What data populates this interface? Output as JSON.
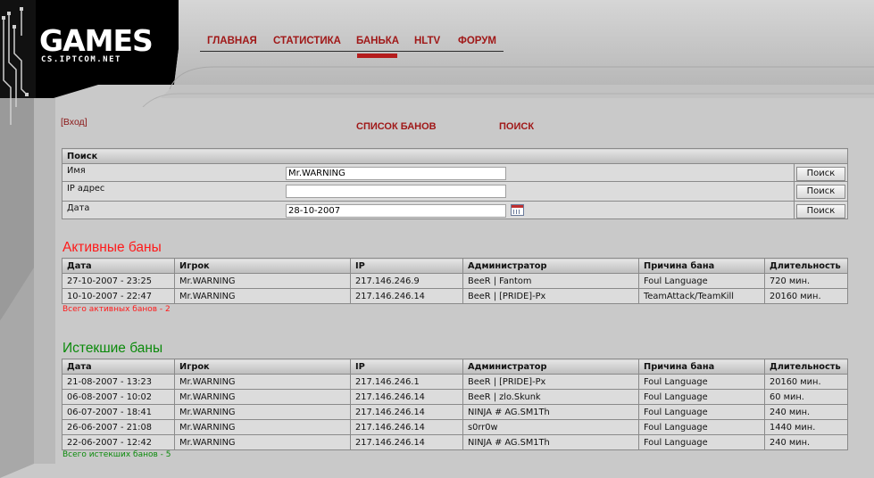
{
  "logo": {
    "title": "GAMES",
    "subtitle": "CS.IPTCOM.NET"
  },
  "nav": [
    {
      "label": "ГЛАВНАЯ"
    },
    {
      "label": "СТАТИСТИКА"
    },
    {
      "label": "БАНЬКА"
    },
    {
      "label": "HLTV"
    },
    {
      "label": "ФОРУМ"
    }
  ],
  "login": {
    "open": "[",
    "link": "Вход",
    "close": "]"
  },
  "submenu": {
    "ban_list": "СПИСОК БАНОВ",
    "search": "ПОИСК"
  },
  "search": {
    "header": "Поиск",
    "rows": [
      {
        "label": "Имя",
        "value": "Mr.WARNING",
        "button": "Поиск"
      },
      {
        "label": "IP адрес",
        "value": "",
        "button": "Поиск"
      },
      {
        "label": "Дата",
        "value": "28-10-2007",
        "button": "Поиск"
      }
    ]
  },
  "columns": [
    "Дата",
    "Игрок",
    "IP",
    "Администратор",
    "Причина бана",
    "Длительность"
  ],
  "active": {
    "title": "Активные баны",
    "color": "#ff1a1a",
    "rows": [
      [
        "27-10-2007 - 23:25",
        "Mr.WARNING",
        "217.146.246.9",
        "BeeR | Fantom",
        "Foul Language",
        "720 мин."
      ],
      [
        "10-10-2007 - 22:47",
        "Mr.WARNING",
        "217.146.246.14",
        "BeeR | [PRIDE]-Px",
        "TeamAttack/TeamKill",
        "20160 мин."
      ]
    ],
    "total": "Всего активных банов - 2"
  },
  "expired": {
    "title": "Истекшие баны",
    "color": "#0a8a0a",
    "rows": [
      [
        "21-08-2007 - 13:23",
        "Mr.WARNING",
        "217.146.246.1",
        "BeeR | [PRIDE]-Px",
        "Foul Language",
        "20160 мин."
      ],
      [
        "06-08-2007 - 10:02",
        "Mr.WARNING",
        "217.146.246.14",
        "BeeR | zlo.Skunk",
        "Foul Language",
        "60 мин."
      ],
      [
        "06-07-2007 - 18:41",
        "Mr.WARNING",
        "217.146.246.14",
        "NINJA # AG.SM1Th",
        "Foul Language",
        "240 мин."
      ],
      [
        "26-06-2007 - 21:08",
        "Mr.WARNING",
        "217.146.246.14",
        "s0rr0w",
        "Foul Language",
        "1440 мин."
      ],
      [
        "22-06-2007 - 12:42",
        "Mr.WARNING",
        "217.146.246.14",
        "NINJA # AG.SM1Th",
        "Foul Language",
        "240 мин."
      ]
    ],
    "total": "Всего истекших банов - 5"
  }
}
